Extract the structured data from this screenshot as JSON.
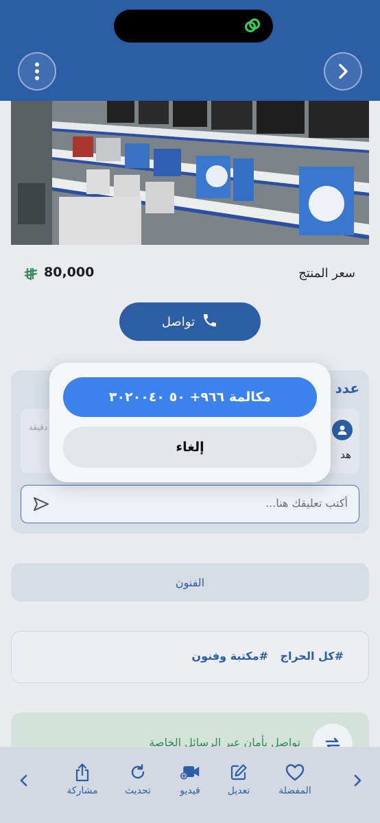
{
  "header": {
    "back_icon": "chevron-right-icon",
    "menu_icon": "more-vertical-icon",
    "island_icon": "link-icon"
  },
  "product": {
    "price_label": "سعر المنتج",
    "price_value": "80,000",
    "currency_icon": "saudi-riyal-icon",
    "contact_label": "تواصل",
    "contact_icon": "phone-icon"
  },
  "comments": {
    "title": "عدد",
    "time": "دقيقة",
    "text": "هد",
    "input_placeholder": "أكتب تعليقك هنا..."
  },
  "category": {
    "label": "الفنون"
  },
  "tags": [
    "#كل الحراج",
    "#مكتبة وفنون"
  ],
  "safe_message": {
    "text": "تواصل بأمان عبر الرسائل الخاصة"
  },
  "toolbar": {
    "favorite": "المفضلة",
    "edit": "تعديل",
    "video": "فيديو",
    "refresh": "تحديث",
    "share": "مشاركة"
  },
  "action_sheet": {
    "call_label": "مكالمة ٩٦٦+ ٥٠ ٣٠٢٠٠٤٠",
    "cancel_label": "إلغاء"
  },
  "colors": {
    "primary": "#2c5ea6",
    "call_button": "#3b82ec",
    "safe_text": "#2f8a55"
  }
}
